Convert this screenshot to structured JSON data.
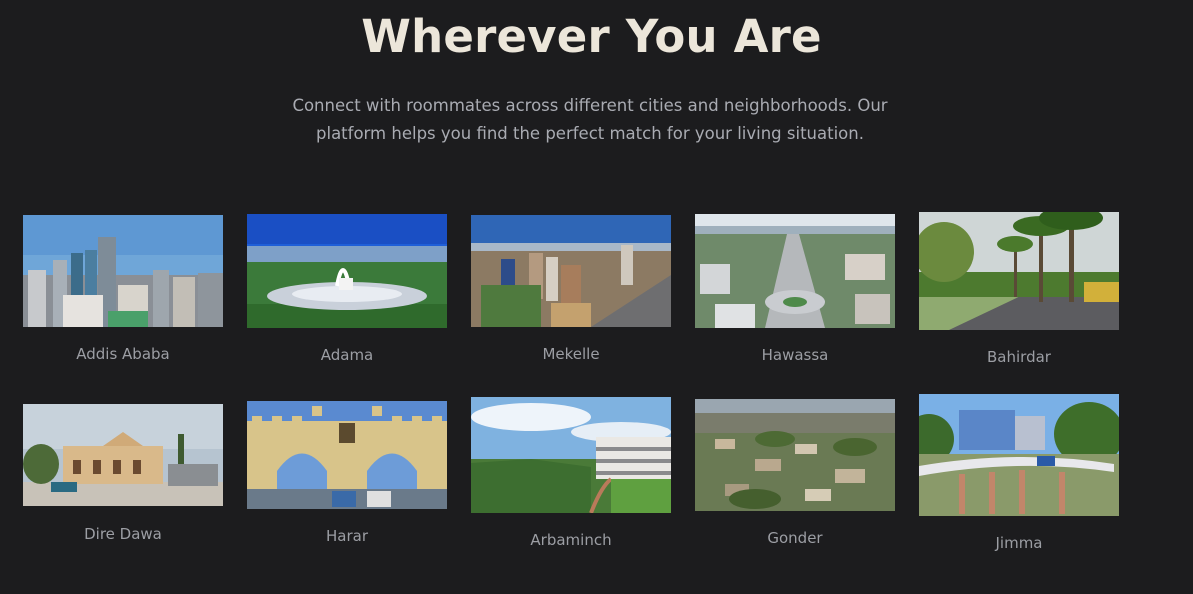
{
  "section": {
    "title": "Wherever You Are",
    "subtitle_line1": "Connect with roommates across different cities and neighborhoods. Our",
    "subtitle_line2": "platform helps you find the perfect match for your living situation."
  },
  "cities": [
    {
      "name": "Addis Ababa"
    },
    {
      "name": "Adama"
    },
    {
      "name": "Mekelle"
    },
    {
      "name": "Hawassa"
    },
    {
      "name": "Bahirdar"
    },
    {
      "name": "Dire Dawa"
    },
    {
      "name": "Harar"
    },
    {
      "name": "Arbaminch"
    },
    {
      "name": "Gonder"
    },
    {
      "name": "Jimma"
    }
  ]
}
